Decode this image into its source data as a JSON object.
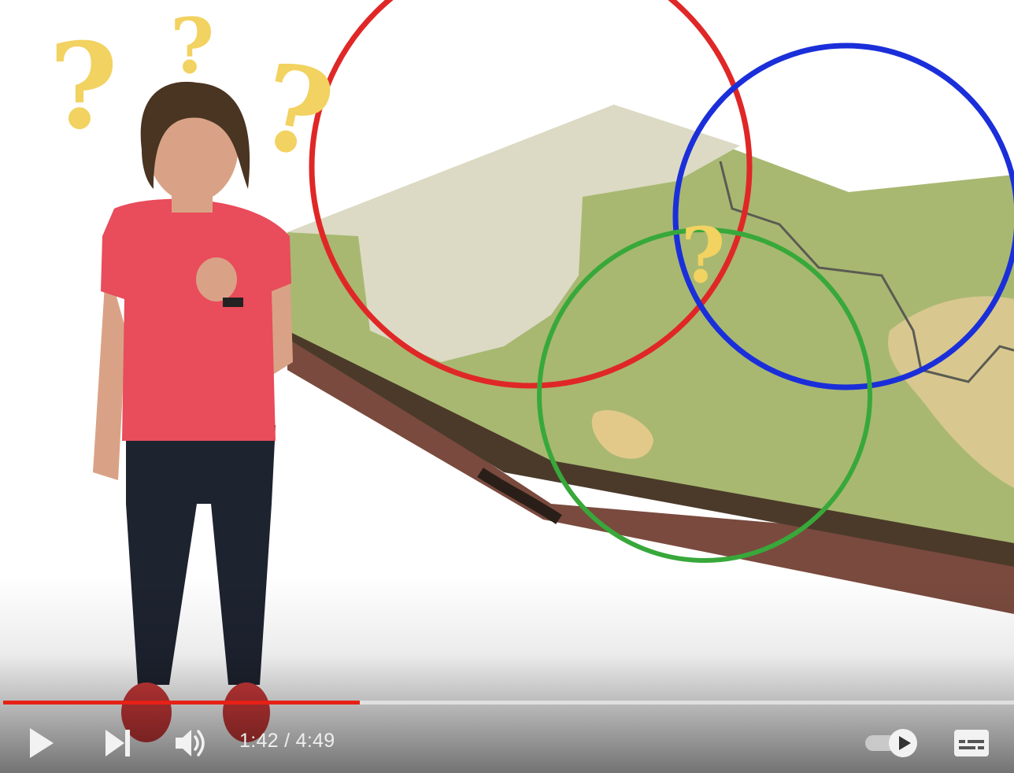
{
  "player": {
    "time": {
      "current": "1:42",
      "separator": "/",
      "duration": "4:49"
    },
    "progress_fraction": 0.353,
    "accent_color": "#e62117",
    "icons": {
      "play": "play-icon",
      "next": "next-icon",
      "volume": "volume-icon",
      "autoplay": "autoplay-toggle-icon",
      "captions": "captions-icon"
    },
    "autoplay_on": true
  }
}
